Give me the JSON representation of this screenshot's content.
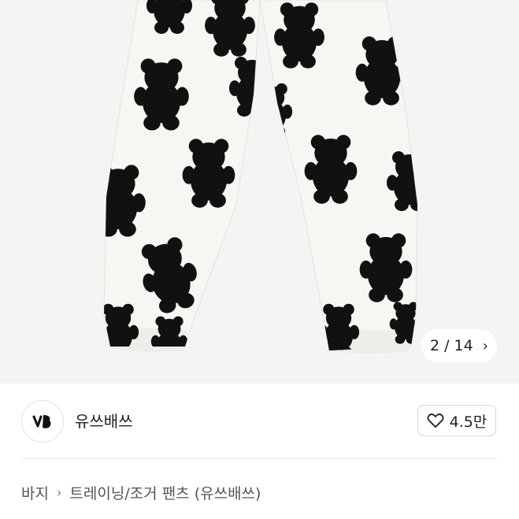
{
  "gallery": {
    "current": "2",
    "separator": "/",
    "total": "14",
    "next_glyph": "›"
  },
  "brand": {
    "name": "유쓰배쓰",
    "logo_icon": "brand-logo-icon"
  },
  "like": {
    "count": "4.5만",
    "icon": "heart-outline-icon"
  },
  "breadcrumb": {
    "items": [
      "바지",
      "트레이닝/조거 팬츠 (유쓰배쓰)"
    ],
    "separator": "›"
  },
  "colors": {
    "pants": "#f7f6f3",
    "bear": "#111111",
    "background": "#f4f4f4"
  }
}
